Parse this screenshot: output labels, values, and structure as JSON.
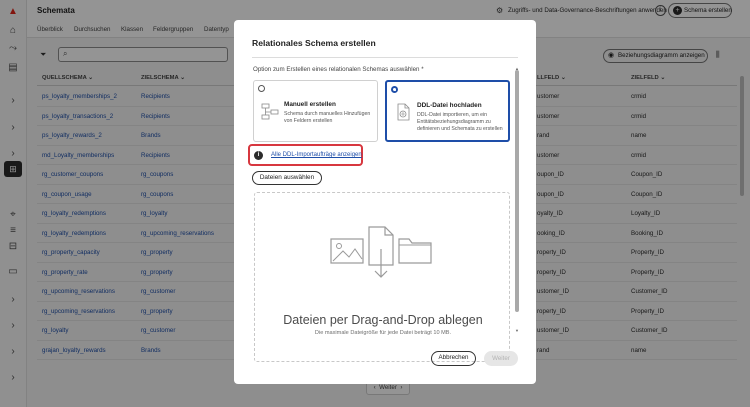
{
  "app": {
    "title": "Schemata",
    "governance_label": "Zugriffs- und Data-Governance-Beschriftungen anwenden",
    "create_schema_label": "Schema erstellen",
    "info_label": "i"
  },
  "tabs": [
    "Überblick",
    "Durchsuchen",
    "Klassen",
    "Feldergruppen",
    "Datentyp"
  ],
  "toolbar": {
    "relationship_button": "Beziehungsdiagramm anzeigen"
  },
  "table": {
    "headers": {
      "source": "QUELLSCHEMA",
      "target": "ZIELSCHEMA",
      "source_field": "LLFELD",
      "target_field": "ZIELFELD"
    },
    "rows": [
      {
        "source": "ps_loyalty_memberships_2",
        "target": "Recipients",
        "source_field": "ustomer",
        "target_field": "crmid"
      },
      {
        "source": "ps_loyalty_transactions_2",
        "target": "Recipients",
        "source_field": "ustomer",
        "target_field": "crmid"
      },
      {
        "source": "ps_loyalty_rewards_2",
        "target": "Brands",
        "source_field": "rand",
        "target_field": "name"
      },
      {
        "source": "md_Loyalty_memberships",
        "target": "Recipients",
        "source_field": "ustomer",
        "target_field": "crmid"
      },
      {
        "source": "rg_customer_coupons",
        "target": "rg_coupons",
        "source_field": "oupon_ID",
        "target_field": "Coupon_ID"
      },
      {
        "source": "rg_coupon_usage",
        "target": "rg_coupons",
        "source_field": "oupon_ID",
        "target_field": "Coupon_ID"
      },
      {
        "source": "rg_loyalty_redemptions",
        "target": "rg_loyalty",
        "source_field": "oyalty_ID",
        "target_field": "Loyalty_ID"
      },
      {
        "source": "rg_loyalty_redemptions",
        "target": "rg_upcoming_reservations",
        "source_field": "ooking_ID",
        "target_field": "Booking_ID"
      },
      {
        "source": "rg_property_capacity",
        "target": "rg_property",
        "source_field": "roperty_ID",
        "target_field": "Property_ID"
      },
      {
        "source": "rg_property_rate",
        "target": "rg_property",
        "source_field": "roperty_ID",
        "target_field": "Property_ID"
      },
      {
        "source": "rg_upcoming_reservations",
        "target": "rg_customer",
        "source_field": "ustomer_ID",
        "target_field": "Customer_ID"
      },
      {
        "source": "rg_upcoming_reservations",
        "target": "rg_property",
        "source_field": "roperty_ID",
        "target_field": "Property_ID"
      },
      {
        "source": "rg_loyalty",
        "target": "rg_customer",
        "source_field": "ustomer_ID",
        "target_field": "Customer_ID"
      },
      {
        "source": "grajan_loyalty_rewards",
        "target": "Brands",
        "source_field": "rand",
        "target_field": "name"
      }
    ]
  },
  "pager": {
    "next_label": "Weiter"
  },
  "modal": {
    "title": "Relationales Schema erstellen",
    "option_label": "Option zum Erstellen eines relationalen Schemas auswählen",
    "option_required": "*",
    "cards": [
      {
        "title": "Manuell erstellen",
        "description": "Schema durch manuelles Hinzufügen von Feldern erstellen",
        "selected": false
      },
      {
        "title": "DDL-Datei hochladen",
        "description": "DDL-Datei importieren, um ein Entitätsbeziehungsdiagramm zu definieren und Schemata zu erstellen",
        "selected": true
      }
    ],
    "info_icon_label": "i",
    "all_imports_link": "Alle DDL-Importaufträge anzeigen",
    "choose_files": "Dateien auswählen",
    "dropzone_title": "Dateien per Drag-and-Drop ablegen",
    "dropzone_subtitle": "Die maximale Dateigröße für jede Datei beträgt 10 MB.",
    "cancel": "Abbrechen",
    "next": "Weiter"
  },
  "colors": {
    "link": "#1e4ea8",
    "highlight": "#d7373f",
    "overlay": "rgba(0,0,0,0.42)"
  }
}
